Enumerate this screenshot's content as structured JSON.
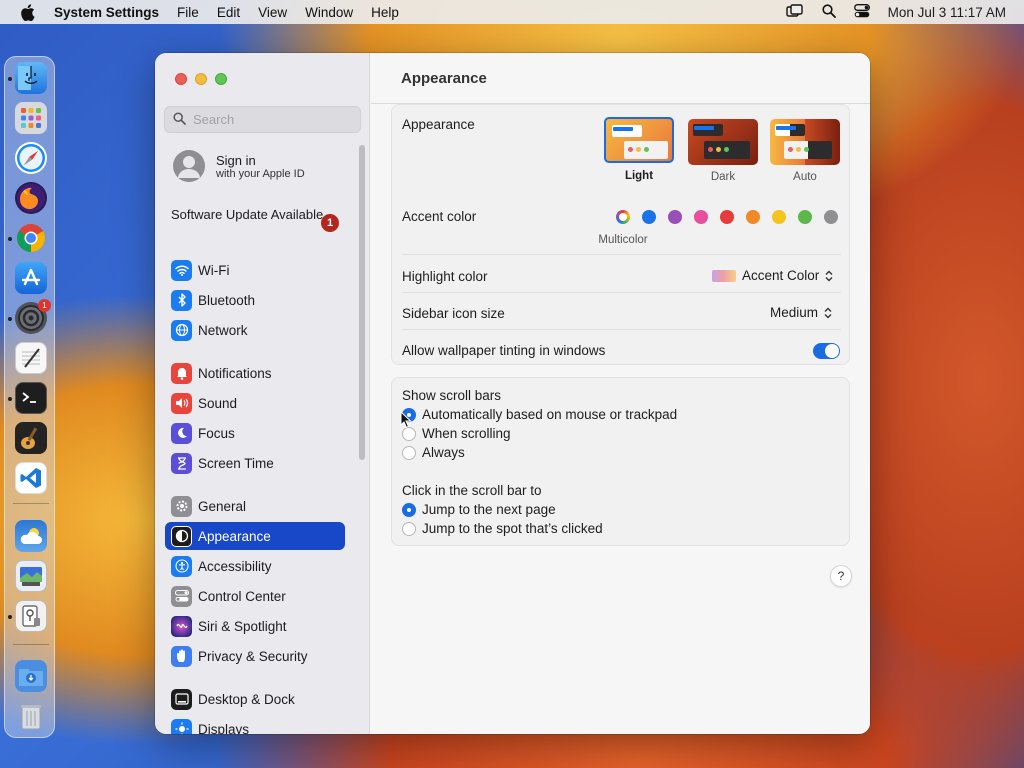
{
  "menubar": {
    "apple_icon": "apple-logo",
    "app_name": "System Settings",
    "items": [
      "File",
      "Edit",
      "View",
      "Window",
      "Help"
    ],
    "clock": "Mon Jul 3  11:17 AM",
    "status_icons": [
      "screen-mirroring-icon",
      "spotlight-search-icon",
      "control-center-icon"
    ]
  },
  "dock": {
    "apps": [
      "Finder",
      "Launchpad",
      "Safari",
      "Firefox",
      "Chrome",
      "App Store",
      "System Settings",
      "TextEdit",
      "Terminal",
      "GarageBand",
      "Visual Studio Code",
      "Weather",
      "Preview",
      "Script Editor",
      "Downloads",
      "Trash"
    ],
    "settings_badge": "1"
  },
  "sidebar": {
    "search_placeholder": "Search",
    "signin_title": "Sign in",
    "signin_subtitle": "with your Apple ID",
    "update_label": "Software Update Available",
    "update_badge": "1",
    "items": [
      {
        "label": "Wi-Fi",
        "color": "#1a7cf0"
      },
      {
        "label": "Bluetooth",
        "color": "#1a7cf0"
      },
      {
        "label": "Network",
        "color": "#1a7cf0"
      },
      {
        "label": "Notifications",
        "color": "#e8453c"
      },
      {
        "label": "Sound",
        "color": "#e8453c"
      },
      {
        "label": "Focus",
        "color": "#5a4fd6"
      },
      {
        "label": "Screen Time",
        "color": "#5a4fd6"
      },
      {
        "label": "General",
        "color": "#8e8e93"
      },
      {
        "label": "Appearance",
        "color": "#1c1c1e"
      },
      {
        "label": "Accessibility",
        "color": "#1a7cf0"
      },
      {
        "label": "Control Center",
        "color": "#8e8e93"
      },
      {
        "label": "Siri & Spotlight",
        "color": "#3a2f8f"
      },
      {
        "label": "Privacy & Security",
        "color": "#3f7ef0"
      },
      {
        "label": "Desktop & Dock",
        "color": "#1c1c1e"
      },
      {
        "label": "Displays",
        "color": "#1a7cf0"
      }
    ],
    "selected": "Appearance"
  },
  "content": {
    "title": "Appearance",
    "appearance": {
      "label": "Appearance",
      "options": [
        "Light",
        "Dark",
        "Auto"
      ],
      "selected": "Light"
    },
    "accent": {
      "label": "Accent color",
      "selected_name": "Multicolor",
      "colors": [
        "#1a73e8",
        "#9b4fb6",
        "#e84e9c",
        "#e63c3c",
        "#f08a24",
        "#f4c51c",
        "#5cb84a",
        "#8e8e93"
      ]
    },
    "highlight": {
      "label": "Highlight color",
      "value": "Accent Color"
    },
    "sidebar_icon_size": {
      "label": "Sidebar icon size",
      "value": "Medium"
    },
    "wallpaper_tinting": {
      "label": "Allow wallpaper tinting in windows",
      "enabled": true
    },
    "scroll_bars": {
      "label": "Show scroll bars",
      "options": [
        "Automatically based on mouse or trackpad",
        "When scrolling",
        "Always"
      ],
      "selected": "Automatically based on mouse or trackpad"
    },
    "scroll_click": {
      "label": "Click in the scroll bar to",
      "options": [
        "Jump to the next page",
        "Jump to the spot that’s clicked"
      ],
      "selected": "Jump to the next page"
    },
    "help": "?"
  }
}
